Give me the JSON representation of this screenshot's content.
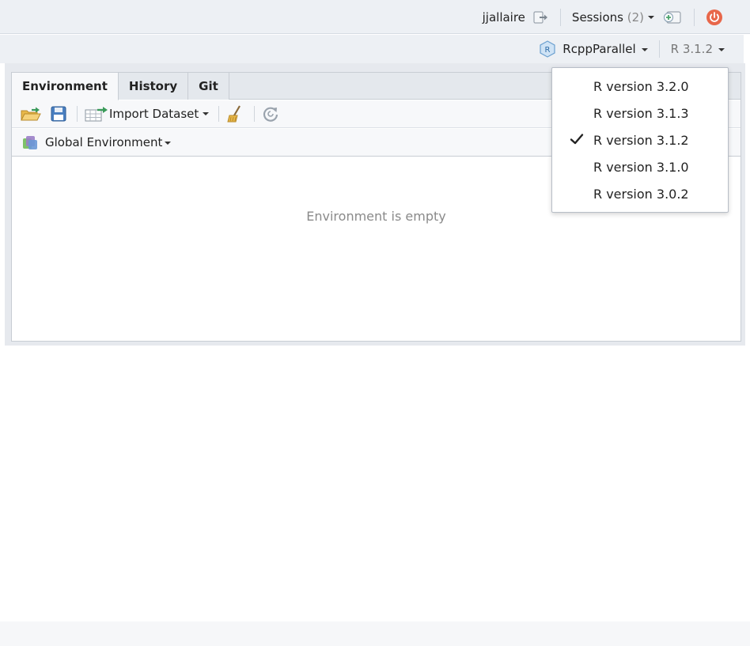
{
  "topbar": {
    "user": "jjallaire",
    "sessions_label": "Sessions",
    "sessions_count": "(2)",
    "icons": [
      "signout-icon",
      "new-session-icon",
      "power-icon"
    ]
  },
  "projbar": {
    "project": "RcppParallel",
    "r_version": "R 3.1.2"
  },
  "tabs": [
    {
      "label": "Environment",
      "active": true
    },
    {
      "label": "History",
      "active": false
    },
    {
      "label": "Git",
      "active": false
    }
  ],
  "toolbar": {
    "import_label": "Import Dataset"
  },
  "env": {
    "scope_label": "Global Environment",
    "empty_message": "Environment is empty"
  },
  "r_versions": {
    "items": [
      {
        "label": "R version 3.2.0",
        "checked": false
      },
      {
        "label": "R version 3.1.3",
        "checked": false
      },
      {
        "label": "R version 3.1.2",
        "checked": true
      },
      {
        "label": "R version 3.1.0",
        "checked": false
      },
      {
        "label": "R version 3.0.2",
        "checked": false
      }
    ]
  },
  "colors": {
    "power": "#e8674a",
    "accent": "#4a90d9"
  }
}
